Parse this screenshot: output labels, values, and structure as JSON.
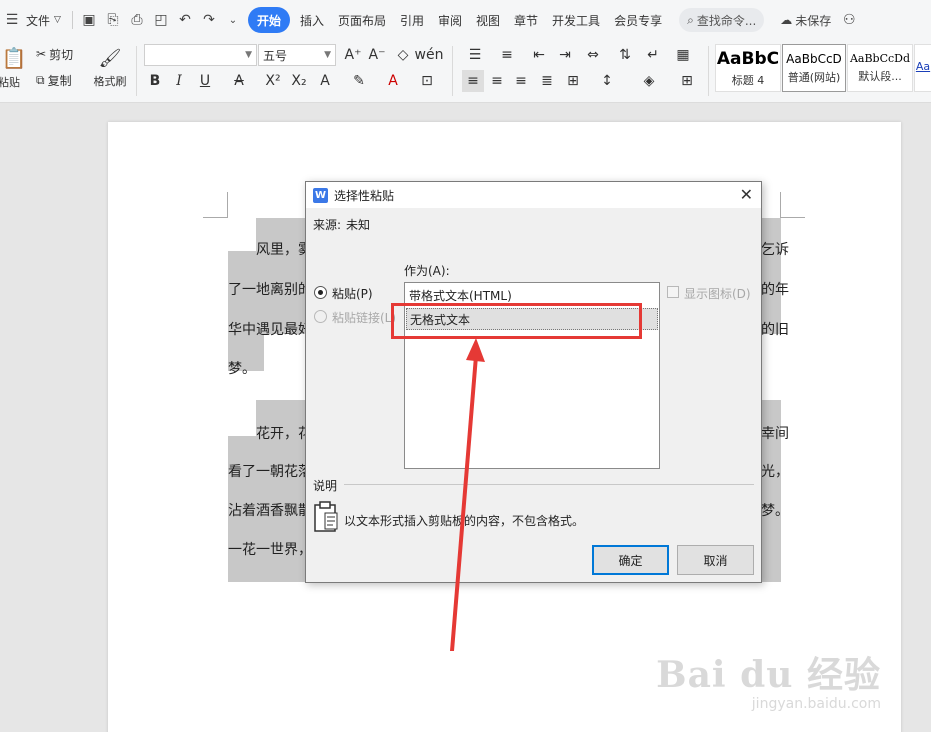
{
  "menubar": {
    "file_label": "文件",
    "tabs": [
      "开始",
      "插入",
      "页面布局",
      "引用",
      "审阅",
      "视图",
      "章节",
      "开发工具",
      "会员专享"
    ],
    "search_label": "查找命令...",
    "unsaved_label": "未保存"
  },
  "ribbon": {
    "cut_label": "剪切",
    "copy_label": "复制",
    "paste_label": "粘贴",
    "format_painter_label": "格式刷",
    "font_name": "",
    "font_size": "五号",
    "styles": [
      {
        "sample": "AaBbC",
        "name": "标题 4"
      },
      {
        "sample": "AaBbCcD",
        "name": "普通(网站)"
      },
      {
        "sample": "AaBbCcDd",
        "name": "默认段..."
      },
      {
        "sample": "Aa",
        "name": ""
      }
    ]
  },
  "document": {
    "lines": [
      "风里，雾",
      "了一地离别的",
      "华中遇见最好",
      "梦。",
      "花开，花",
      "看了一朝花落",
      "沾着酒香飘散",
      "一花一世界，"
    ],
    "right_fragments": [
      "乞诉",
      "的年",
      "的旧",
      "幸间",
      "光，",
      "梦。"
    ]
  },
  "dialog": {
    "title": "选择性粘贴",
    "source_label": "来源:",
    "source_value": "未知",
    "as_label": "作为(A):",
    "paste_radio_label": "粘贴(P)",
    "paste_link_radio_label": "粘贴链接(L)",
    "list_items": [
      "带格式文本(HTML)",
      "无格式文本"
    ],
    "selected_index": 1,
    "show_icon_label": "显示图标(D)",
    "description_label": "说明",
    "description_text": "以文本形式插入剪贴板的内容，不包含格式。",
    "ok_label": "确定",
    "cancel_label": "取消"
  },
  "watermark": {
    "brand": "Bai du 经验",
    "url": "jingyan.baidu.com"
  },
  "colors": {
    "accent": "#2f7bf5",
    "annotation": "#e53935"
  }
}
